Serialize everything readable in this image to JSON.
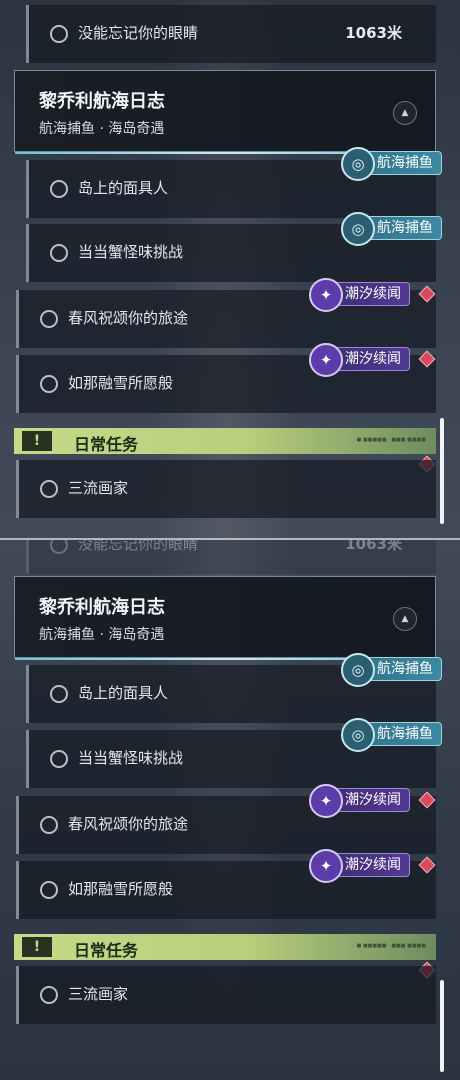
{
  "top_row": {
    "label": "没能忘记你的眼睛",
    "distance": "1063米"
  },
  "quest_group": {
    "title": "黎乔利航海日志",
    "subtitle": "航海捕鱼 · 海岛奇遇"
  },
  "quests": [
    {
      "label": "岛上的面具人",
      "tag": "航海捕鱼",
      "tag_kind": "fishing"
    },
    {
      "label": "当当蟹怪味挑战",
      "tag": "航海捕鱼",
      "tag_kind": "fishing"
    },
    {
      "label": "春风祝颂你的旅途",
      "tag": "潮汐续闻",
      "tag_kind": "tide"
    },
    {
      "label": "如那融雪所愿般",
      "tag": "潮汐续闻",
      "tag_kind": "tide"
    }
  ],
  "daily": {
    "section_title": "日常任务",
    "tiny_text": "■ ■■■■■ · ■■■ ■■■■",
    "items": [
      {
        "label": "三流画家"
      }
    ]
  },
  "colors": {
    "fishing_tag": "#3c8aa3",
    "tide_tag": "#523a92",
    "daily_banner": "#c6da8a",
    "gem": "#d94a5a"
  },
  "icons": {
    "collapse": "chevron-up-icon",
    "daily": "exclamation-icon",
    "gem": "diamond-icon",
    "fishing": "swirl-icon",
    "tide": "sparkle-icon"
  }
}
